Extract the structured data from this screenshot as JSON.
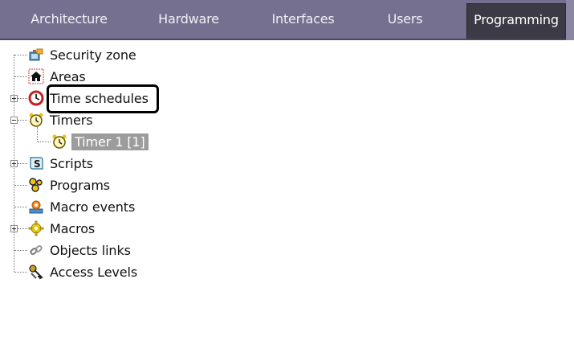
{
  "tabs": [
    {
      "label": "Architecture",
      "active": false
    },
    {
      "label": "Hardware",
      "active": false
    },
    {
      "label": "Interfaces",
      "active": false
    },
    {
      "label": "Users",
      "active": false
    },
    {
      "label": "Programming",
      "active": true
    }
  ],
  "tree": {
    "items": [
      {
        "label": "Security zone",
        "icon": "security-zone-icon"
      },
      {
        "label": "Areas",
        "icon": "house-icon"
      },
      {
        "label": "Time schedules",
        "icon": "clock-icon",
        "expander": "plus"
      },
      {
        "label": "Timers",
        "icon": "alarm-clock-icon",
        "expander": "minus"
      },
      {
        "label": "Timer 1 [1]",
        "icon": "alarm-clock-icon",
        "selected": true
      },
      {
        "label": "Scripts",
        "icon": "script-icon",
        "expander": "plus"
      },
      {
        "label": "Programs",
        "icon": "programs-icon"
      },
      {
        "label": "Macro events",
        "icon": "macro-event-icon"
      },
      {
        "label": "Macros",
        "icon": "gear-icon",
        "expander": "plus"
      },
      {
        "label": "Objects links",
        "icon": "link-icon"
      },
      {
        "label": "Access Levels",
        "icon": "keys-icon"
      }
    ]
  },
  "colors": {
    "tabbar": "#75708f",
    "active_tab": "#3c3a45",
    "selection": "#9c9c9c"
  }
}
